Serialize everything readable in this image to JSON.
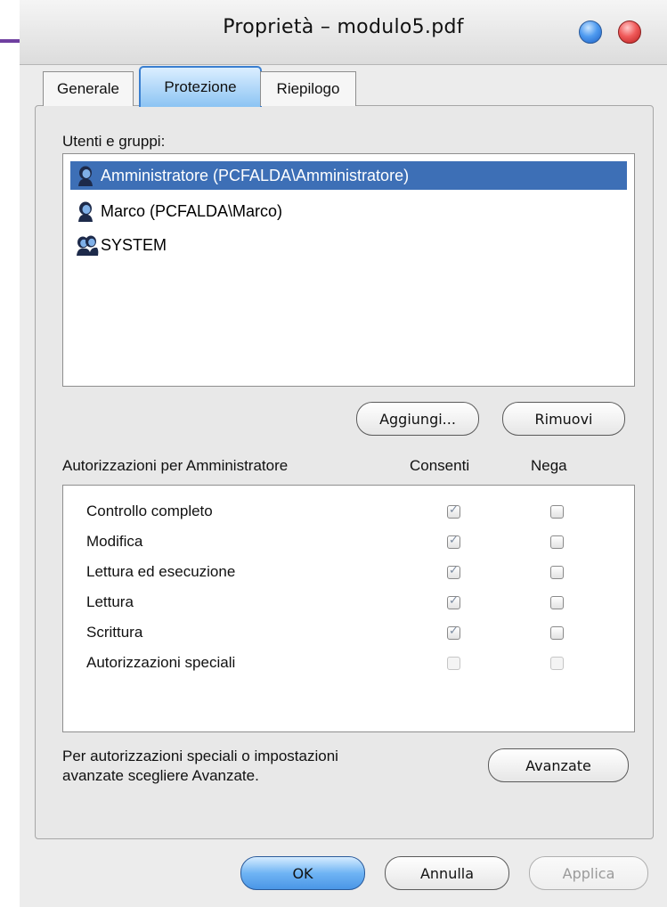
{
  "window": {
    "title": "Proprietà – modulo5.pdf"
  },
  "tabs": [
    {
      "label": "Generale"
    },
    {
      "label": "Protezione"
    },
    {
      "label": "Riepilogo"
    }
  ],
  "users": {
    "label": "Utenti e gruppi:",
    "items": [
      {
        "name": "Amministratore (PCFALDA\\Amministratore)",
        "icon": "user-icon",
        "selected": true
      },
      {
        "name": "Marco (PCFALDA\\Marco)",
        "icon": "user-icon",
        "selected": false
      },
      {
        "name": "SYSTEM",
        "icon": "group-icon",
        "selected": false
      }
    ],
    "add_label": "Aggiungi...",
    "remove_label": "Rimuovi"
  },
  "permissions": {
    "title": "Autorizzazioni per Amministratore",
    "allow_header": "Consenti",
    "deny_header": "Nega",
    "rows": [
      {
        "name": "Controllo completo",
        "allow": true,
        "deny": false,
        "enabled": true
      },
      {
        "name": "Modifica",
        "allow": true,
        "deny": false,
        "enabled": true
      },
      {
        "name": "Lettura ed esecuzione",
        "allow": true,
        "deny": false,
        "enabled": true
      },
      {
        "name": "Lettura",
        "allow": true,
        "deny": false,
        "enabled": true
      },
      {
        "name": "Scrittura",
        "allow": true,
        "deny": false,
        "enabled": true
      },
      {
        "name": "Autorizzazioni speciali",
        "allow": false,
        "deny": false,
        "enabled": false
      }
    ]
  },
  "advanced": {
    "note_line1": "Per autorizzazioni speciali o impostazioni",
    "note_line2": "avanzate scegliere Avanzate.",
    "button_label": "Avanzate"
  },
  "footer": {
    "ok_label": "OK",
    "cancel_label": "Annulla",
    "apply_label": "Applica",
    "apply_enabled": false
  },
  "colors": {
    "selection": "#3d6fb6",
    "tab_active_border": "#3a7fd0",
    "ok_button": "#6fb4f4"
  }
}
